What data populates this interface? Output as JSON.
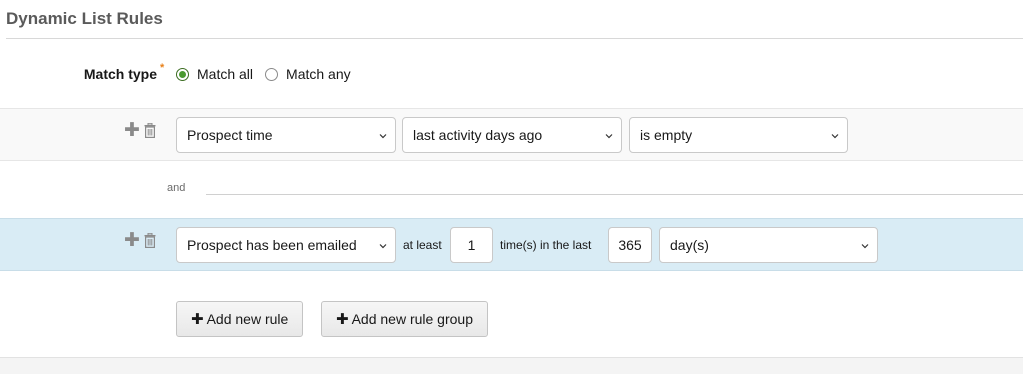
{
  "section": {
    "title": "Dynamic List Rules"
  },
  "match": {
    "label": "Match type",
    "required_mark": "*",
    "options": [
      {
        "label": "Match all",
        "selected": true
      },
      {
        "label": "Match any",
        "selected": false
      }
    ]
  },
  "rules": [
    {
      "field": "Prospect time",
      "operator": "last activity days ago",
      "condition": "is empty"
    },
    {
      "field": "Prospect has been emailed",
      "at_least_label": "at least",
      "count": "1",
      "times_label": "time(s) in the last",
      "period": "365",
      "unit": "day(s)"
    }
  ],
  "conjunction": "and",
  "buttons": {
    "add_rule": "Add new rule",
    "add_group": "Add new rule group"
  },
  "icons": {
    "add": "plus-icon",
    "delete": "trash-icon",
    "dropdown": "chevron-down-icon"
  },
  "colors": {
    "radio_selected": "#4a9a30",
    "highlight_band": "#d9ecf5",
    "required": "#e8811a"
  }
}
